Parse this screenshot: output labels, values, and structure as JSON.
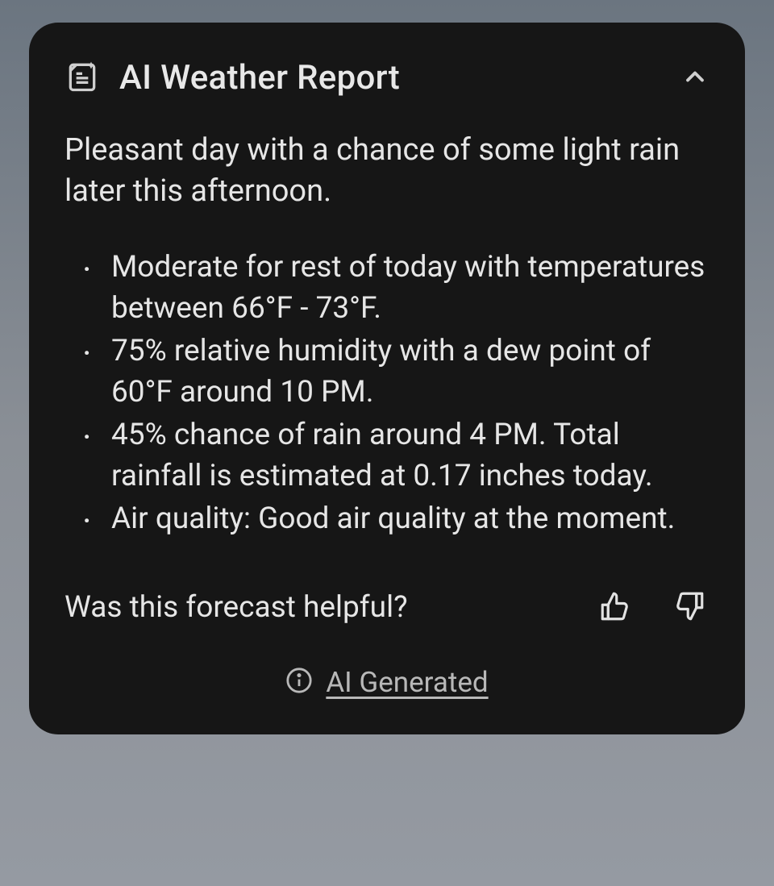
{
  "card": {
    "title": "AI Weather Report",
    "summary": "Pleasant day with a chance of some light rain later this afternoon.",
    "bullets": [
      "Moderate for rest of today with temperatures between 66°F - 73°F.",
      "75% relative humidity with a dew point of 60°F around 10 PM.",
      "45% chance of rain around 4 PM. Total rainfall is estimated at 0.17 inches today.",
      "Air quality: Good air quality at the moment."
    ],
    "feedback_prompt": "Was this forecast helpful?",
    "ai_generated_label": "AI Generated"
  }
}
